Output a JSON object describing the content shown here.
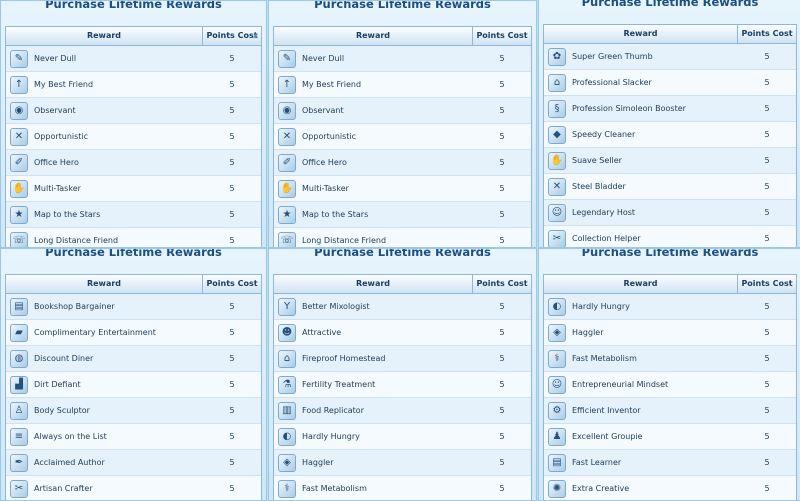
{
  "panels": [
    {
      "title": "Purchase Lifetime Rewards",
      "col_reward": "Reward",
      "col_cost": "Points Cost",
      "rows": [
        {
          "name": "Never Dull",
          "cost": "5",
          "icon": "feather-icon",
          "glyph": "✎"
        },
        {
          "name": "My Best Friend",
          "cost": "5",
          "icon": "arrow-up-icon",
          "glyph": "↑"
        },
        {
          "name": "Observant",
          "cost": "5",
          "icon": "eye-icon",
          "glyph": "◉"
        },
        {
          "name": "Opportunistic",
          "cost": "5",
          "icon": "pickaxe-icon",
          "glyph": "✕"
        },
        {
          "name": "Office Hero",
          "cost": "5",
          "icon": "stapler-icon",
          "glyph": "✐"
        },
        {
          "name": "Multi-Tasker",
          "cost": "5",
          "icon": "hands-icon",
          "glyph": "✋"
        },
        {
          "name": "Map to the Stars",
          "cost": "5",
          "icon": "map-icon",
          "glyph": "★"
        },
        {
          "name": "Long Distance Friend",
          "cost": "5",
          "icon": "phone-icon",
          "glyph": "☏"
        }
      ]
    },
    {
      "title": "Purchase Lifetime Rewards",
      "col_reward": "Reward",
      "col_cost": "Points Cost",
      "rows": [
        {
          "name": "Never Dull",
          "cost": "5",
          "icon": "feather-icon",
          "glyph": "✎"
        },
        {
          "name": "My Best Friend",
          "cost": "5",
          "icon": "arrow-up-icon",
          "glyph": "↑"
        },
        {
          "name": "Observant",
          "cost": "5",
          "icon": "eye-icon",
          "glyph": "◉"
        },
        {
          "name": "Opportunistic",
          "cost": "5",
          "icon": "pickaxe-icon",
          "glyph": "✕"
        },
        {
          "name": "Office Hero",
          "cost": "5",
          "icon": "stapler-icon",
          "glyph": "✐"
        },
        {
          "name": "Multi-Tasker",
          "cost": "5",
          "icon": "hands-icon",
          "glyph": "✋"
        },
        {
          "name": "Map to the Stars",
          "cost": "5",
          "icon": "map-icon",
          "glyph": "★"
        },
        {
          "name": "Long Distance Friend",
          "cost": "5",
          "icon": "phone-icon",
          "glyph": "☏"
        }
      ]
    },
    {
      "title": "Purchase Lifetime Rewards",
      "col_reward": "Reward",
      "col_cost": "Points Cost",
      "rows": [
        {
          "name": "Super Green Thumb",
          "cost": "5",
          "icon": "plant-icon",
          "glyph": "✿"
        },
        {
          "name": "Professional Slacker",
          "cost": "5",
          "icon": "chair-icon",
          "glyph": "⌂"
        },
        {
          "name": "Profession Simoleon Booster",
          "cost": "5",
          "icon": "money-icon",
          "glyph": "§"
        },
        {
          "name": "Speedy Cleaner",
          "cost": "5",
          "icon": "sponge-icon",
          "glyph": "◆"
        },
        {
          "name": "Suave Seller",
          "cost": "5",
          "icon": "handshake-icon",
          "glyph": "✋"
        },
        {
          "name": "Steel Bladder",
          "cost": "5",
          "icon": "no-bladder-icon",
          "glyph": "✕"
        },
        {
          "name": "Legendary Host",
          "cost": "5",
          "icon": "party-icon",
          "glyph": "☺"
        },
        {
          "name": "Collection Helper",
          "cost": "5",
          "icon": "tools-icon",
          "glyph": "✂"
        }
      ]
    },
    {
      "title": "Purchase Lifetime Rewards",
      "col_reward": "Reward",
      "col_cost": "Points Cost",
      "rows": [
        {
          "name": "Bookshop Bargainer",
          "cost": "5",
          "icon": "book-icon",
          "glyph": "▤"
        },
        {
          "name": "Complimentary Entertainment",
          "cost": "5",
          "icon": "ticket-icon",
          "glyph": "▰"
        },
        {
          "name": "Discount Diner",
          "cost": "5",
          "icon": "food-icon",
          "glyph": "◍"
        },
        {
          "name": "Dirt Defiant",
          "cost": "5",
          "icon": "shirt-icon",
          "glyph": "▟"
        },
        {
          "name": "Body Sculptor",
          "cost": "5",
          "icon": "body-icon",
          "glyph": "♙"
        },
        {
          "name": "Always on the List",
          "cost": "5",
          "icon": "list-icon",
          "glyph": "≡"
        },
        {
          "name": "Acclaimed Author",
          "cost": "5",
          "icon": "quill-icon",
          "glyph": "✒"
        },
        {
          "name": "Artisan Crafter",
          "cost": "5",
          "icon": "craft-icon",
          "glyph": "✂"
        }
      ]
    },
    {
      "title": "Purchase Lifetime Rewards",
      "col_reward": "Reward",
      "col_cost": "Points Cost",
      "rows": [
        {
          "name": "Better Mixologist",
          "cost": "5",
          "icon": "cocktail-icon",
          "glyph": "Y"
        },
        {
          "name": "Attractive",
          "cost": "5",
          "icon": "face-icon",
          "glyph": "☻"
        },
        {
          "name": "Fireproof Homestead",
          "cost": "5",
          "icon": "house-icon",
          "glyph": "⌂"
        },
        {
          "name": "Fertility Treatment",
          "cost": "5",
          "icon": "bottle-icon",
          "glyph": "⚗"
        },
        {
          "name": "Food Replicator",
          "cost": "5",
          "icon": "fridge-icon",
          "glyph": "▥"
        },
        {
          "name": "Hardly Hungry",
          "cost": "5",
          "icon": "stomach-icon",
          "glyph": "◐"
        },
        {
          "name": "Haggler",
          "cost": "5",
          "icon": "tag-icon",
          "glyph": "◈"
        },
        {
          "name": "Fast Metabolism",
          "cost": "5",
          "icon": "pill-icon",
          "glyph": "⚕"
        }
      ]
    },
    {
      "title": "Purchase Lifetime Rewards",
      "col_reward": "Reward",
      "col_cost": "Points Cost",
      "rows": [
        {
          "name": "Hardly Hungry",
          "cost": "5",
          "icon": "stomach-icon",
          "glyph": "◐"
        },
        {
          "name": "Haggler",
          "cost": "5",
          "icon": "tag-icon",
          "glyph": "◈"
        },
        {
          "name": "Fast Metabolism",
          "cost": "5",
          "icon": "pill-icon",
          "glyph": "⚕"
        },
        {
          "name": "Entrepreneurial Mindset",
          "cost": "5",
          "icon": "head-icon",
          "glyph": "☺"
        },
        {
          "name": "Efficient Inventor",
          "cost": "5",
          "icon": "gear-icon",
          "glyph": "⚙"
        },
        {
          "name": "Excellent Groupie",
          "cost": "5",
          "icon": "group-icon",
          "glyph": "♟"
        },
        {
          "name": "Fast Learner",
          "cost": "5",
          "icon": "book-icon",
          "glyph": "▤"
        },
        {
          "name": "Extra Creative",
          "cost": "5",
          "icon": "palette-icon",
          "glyph": "✺"
        }
      ]
    }
  ]
}
